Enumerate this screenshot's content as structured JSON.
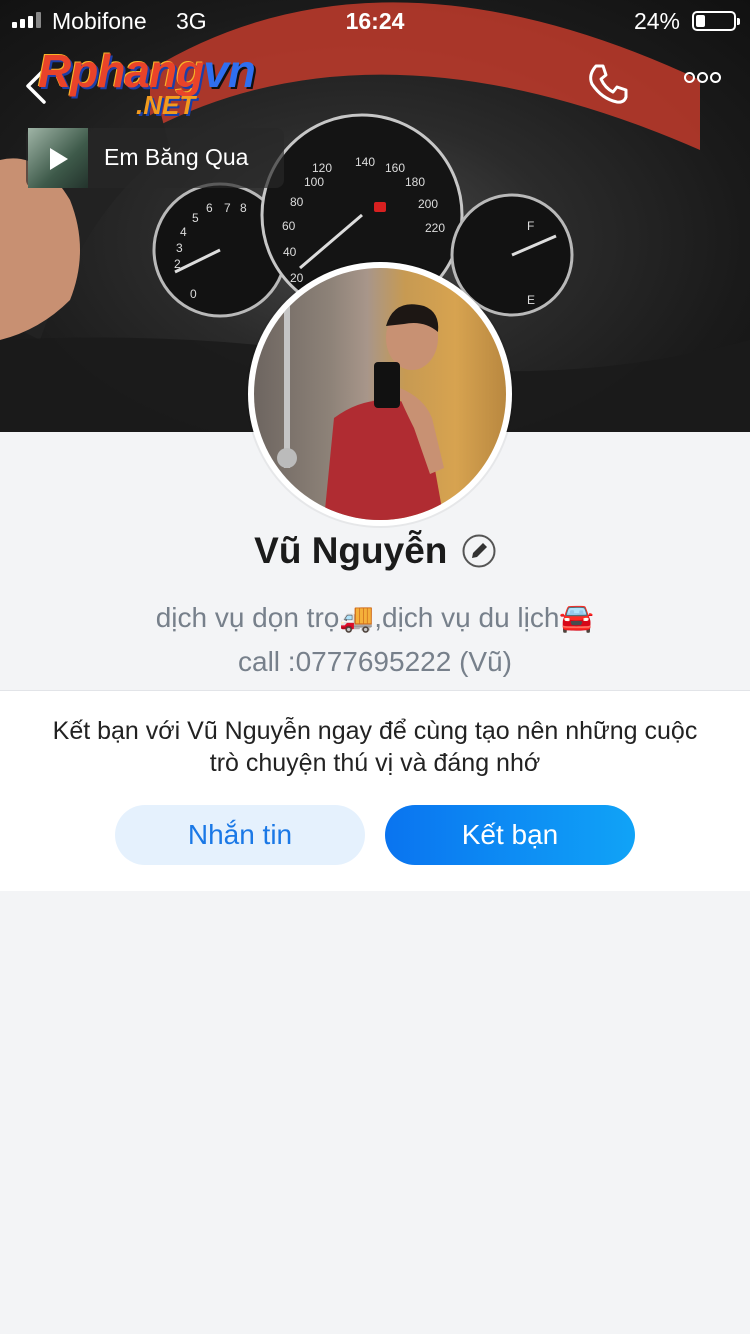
{
  "status_bar": {
    "carrier": "Mobifone",
    "network": "3G",
    "time": "16:24",
    "battery_text": "24%",
    "battery_level": 0.24
  },
  "header": {
    "logo_main": "Rphangvn",
    "logo_sub": ".NET",
    "icons": [
      "back-chevron",
      "phone",
      "more-dots"
    ]
  },
  "music": {
    "title": "Em Băng Qua"
  },
  "profile": {
    "name": "Vũ Nguyễn",
    "bio_line1": "dịch vụ dọn trọ🚚,dịch vụ du lịch🚘",
    "bio_line2": "call :0777695222 (Vũ)"
  },
  "friend_card": {
    "message": "Kết bạn với Vũ Nguyễn ngay để cùng tạo nên những cuộc trò chuyện thú vị và đáng nhớ",
    "message_button": "Nhắn tin",
    "add_friend_button": "Kết bạn"
  },
  "colors": {
    "accent": "#0a84f5",
    "background": "#f3f4f6",
    "secondary_button_bg": "#e5f1fd"
  }
}
